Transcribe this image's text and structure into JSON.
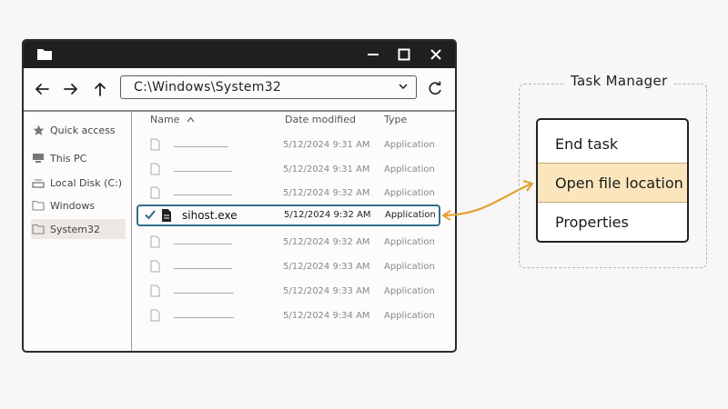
{
  "explorer": {
    "address": "C:\\Windows\\System32",
    "sidebar": [
      {
        "label": "Quick access",
        "icon": "star-icon"
      },
      {
        "label": "This PC",
        "icon": "computer-icon"
      },
      {
        "label": "Local Disk (C:)",
        "icon": "drive-icon"
      },
      {
        "label": "Windows",
        "icon": "folder-icon"
      },
      {
        "label": "System32",
        "icon": "folder-icon",
        "selected": true
      }
    ],
    "columns": {
      "name": "Name",
      "date": "Date modified",
      "type": "Type"
    },
    "rows": [
      {
        "name": "",
        "date": "5/12/2024  9:31 AM",
        "type": "Application"
      },
      {
        "name": "",
        "date": "5/12/2024  9:31 AM",
        "type": "Application"
      },
      {
        "name": "",
        "date": "5/12/2024  9:32 AM",
        "type": "Application"
      },
      {
        "name": "sihost.exe",
        "date": "5/12/2024  9:32 AM",
        "type": "Application",
        "selected": true
      },
      {
        "name": "",
        "date": "5/12/2024  9:32 AM",
        "type": "Application"
      },
      {
        "name": "",
        "date": "5/12/2024  9:33 AM",
        "type": "Application"
      },
      {
        "name": "",
        "date": "5/12/2024  9:33 AM",
        "type": "Application"
      },
      {
        "name": "",
        "date": "5/12/2024  9:34 AM",
        "type": "Application"
      }
    ]
  },
  "task_manager": {
    "title": "Task Manager",
    "menu": [
      {
        "label": "End task"
      },
      {
        "label": "Open file location",
        "highlighted": true
      },
      {
        "label": "Properties"
      }
    ]
  },
  "colors": {
    "titlebar": "#1f1f1f",
    "selection_border": "#2e6e8e",
    "menu_highlight": "#fbe5bd",
    "arrow": "#e3a232"
  }
}
